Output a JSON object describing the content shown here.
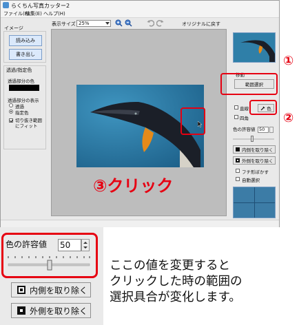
{
  "app": {
    "title": "らくちん写真カッター2",
    "menu": [
      "ファイル(F)",
      "編集(E)",
      "ヘルプ(H)"
    ]
  },
  "left_panel": {
    "image_group": "イメージ",
    "load_button": "読み込み",
    "write_button": "書き出し",
    "transparency_group": "透過/指定色",
    "transparent_color_label": "透過部分の色",
    "display_label": "透過部分の表示",
    "radio_transparent": "透過",
    "radio_specified": "指定色",
    "fit_label": "切り抜き範囲にフィット"
  },
  "toolbar": {
    "zoom_label": "表示サイズ",
    "zoom_value": "25%",
    "reset_label": "オリジナルに戻す"
  },
  "right_panel": {
    "move_label": "移動",
    "range_select_button": "範囲選択",
    "color_button": "色",
    "tolerance_label": "色の許容値",
    "tolerance_value": "50",
    "remove_inside": "内側を取り除く",
    "remove_outside": "外側を取り除く",
    "border_soften": "フチ形ぼかす",
    "auto_select": "自動選択",
    "opt_1": "直線",
    "opt_2": "四角"
  },
  "annotations": {
    "step1": "①",
    "step2": "②",
    "step3": "③クリック"
  },
  "zoom_detail": {
    "tolerance_label": "色の許容値",
    "tolerance_value": "50",
    "remove_inside": "内側を取り除く",
    "remove_outside": "外側を取り除く"
  },
  "explanation": {
    "line1": "ここの値を変更すると",
    "line2": "クリックした時の範囲の",
    "line3": "選択具合が変化します。"
  },
  "colors": {
    "annotation_red": "#e60012",
    "photo_water": "#2f7fa8"
  }
}
